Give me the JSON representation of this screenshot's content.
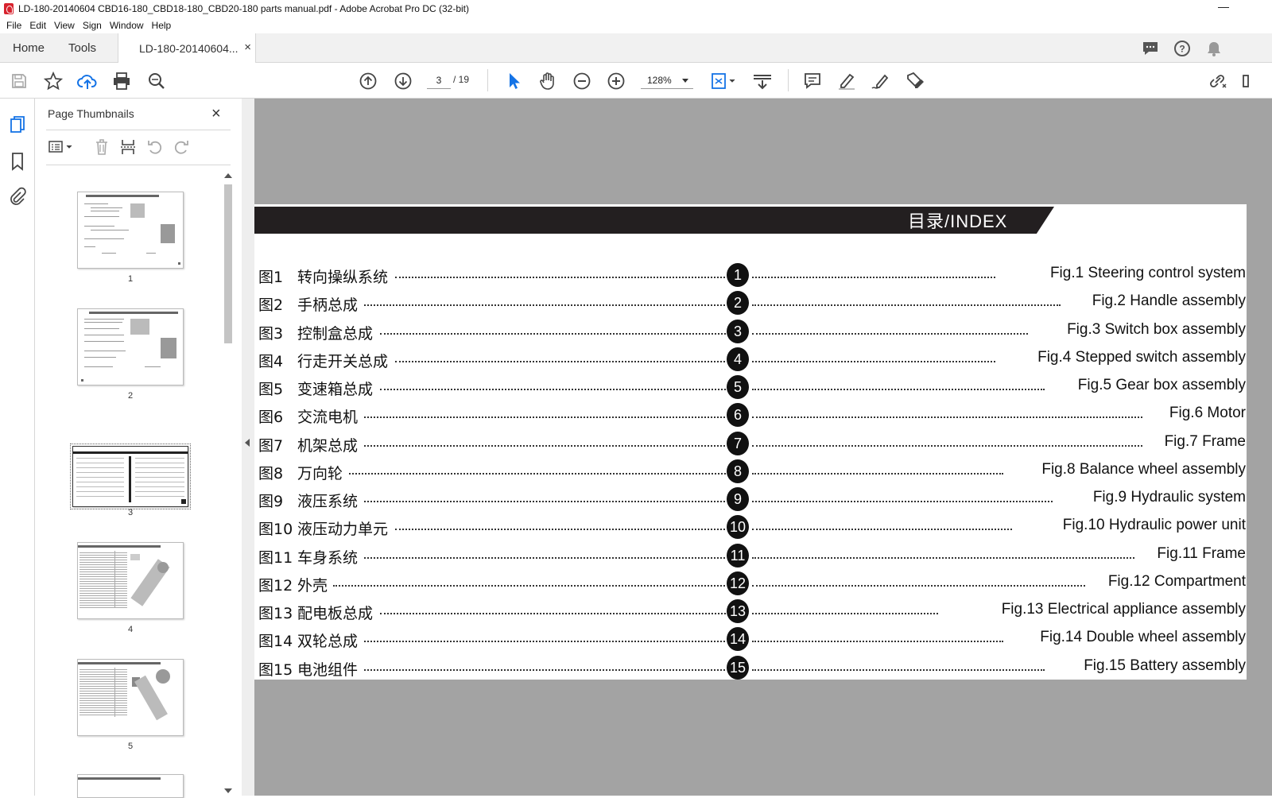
{
  "window": {
    "title": "LD-180-20140604 CBD16-180_CBD18-180_CBD20-180 parts manual.pdf - Adobe Acrobat Pro DC (32-bit)",
    "minimize": "—"
  },
  "menu": [
    "File",
    "Edit",
    "View",
    "Sign",
    "Window",
    "Help"
  ],
  "tabs": {
    "home": "Home",
    "tools": "Tools",
    "doc": "LD-180-20140604...",
    "close": "×"
  },
  "toolbar": {
    "page_current": "3",
    "page_total": "/ 19",
    "zoom": "128%"
  },
  "thumbnails": {
    "header": "Page Thumbnails",
    "close": "×",
    "pages": [
      "1",
      "2",
      "3",
      "4",
      "5"
    ],
    "selected_page": "3"
  },
  "document": {
    "index_title": "目录/INDEX",
    "entries": [
      {
        "num": "图1",
        "cn": "转向操纵系统",
        "badge": "1",
        "en": "Fig.1  Steering control system"
      },
      {
        "num": "图2",
        "cn": "手柄总成",
        "badge": "2",
        "en": "Fig.2  Handle assembly"
      },
      {
        "num": "图3",
        "cn": "控制盒总成",
        "badge": "3",
        "en": "Fig.3  Switch box assembly"
      },
      {
        "num": "图4",
        "cn": "行走开关总成",
        "badge": "4",
        "en": "Fig.4  Stepped switch assembly"
      },
      {
        "num": "图5",
        "cn": "变速箱总成",
        "badge": "5",
        "en": "Fig.5  Gear box assembly"
      },
      {
        "num": "图6",
        "cn": "交流电机",
        "badge": "6",
        "en": "Fig.6  Motor"
      },
      {
        "num": "图7",
        "cn": "机架总成",
        "badge": "7",
        "en": "Fig.7  Frame"
      },
      {
        "num": "图8",
        "cn": "万向轮",
        "badge": "8",
        "en": "Fig.8  Balance wheel assembly"
      },
      {
        "num": "图9",
        "cn": "液压系统",
        "badge": "9",
        "en": "Fig.9  Hydraulic system"
      },
      {
        "num": "图10",
        "cn": "液压动力单元",
        "badge": "10",
        "en": "Fig.10  Hydraulic power unit"
      },
      {
        "num": "图11",
        "cn": "车身系统",
        "badge": "11",
        "en": "Fig.11  Frame"
      },
      {
        "num": "图12",
        "cn": "外壳",
        "badge": "12",
        "en": "Fig.12  Compartment"
      },
      {
        "num": "图13",
        "cn": "配电板总成",
        "badge": "13",
        "en": "Fig.13  Electrical appliance assembly"
      },
      {
        "num": "图14",
        "cn": "双轮总成",
        "badge": "14",
        "en": "Fig.14  Double wheel assembly"
      },
      {
        "num": "图15",
        "cn": "电池组件",
        "badge": "15",
        "en": "Fig.15  Battery assembly"
      }
    ]
  },
  "colors": {
    "banner": "#231f20",
    "doc_background": "#a3a3a3",
    "accent_blue": "#1473e6",
    "acrobat_red": "#d7232e"
  },
  "icons": {
    "toolbar": [
      "save-icon",
      "star-icon",
      "cloud-upload-icon",
      "print-icon",
      "search-icon",
      "page-up-icon",
      "page-down-icon",
      "select-cursor-icon",
      "hand-icon",
      "zoom-out-icon",
      "zoom-in-icon",
      "fit-page-icon",
      "scroll-mode-icon",
      "comment-icon",
      "highlight-icon",
      "sign-icon",
      "edit-pdf-icon",
      "share-link-icon"
    ],
    "rail": [
      "thumbnails-icon",
      "bookmark-icon",
      "attachment-icon"
    ]
  }
}
